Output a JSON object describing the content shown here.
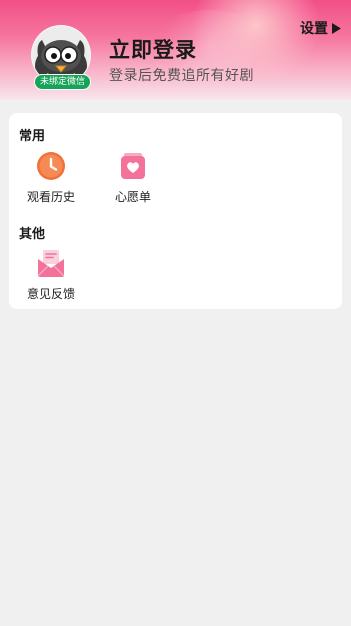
{
  "header": {
    "avatar_badge": "未绑定微信",
    "login_title": "立即登录",
    "login_subtitle": "登录后免费追所有好剧",
    "settings_label": "设置"
  },
  "sections": [
    {
      "title": "常用",
      "items": [
        {
          "label": "观看历史",
          "icon": "history-clock-icon"
        },
        {
          "label": "心愿单",
          "icon": "wishlist-heart-icon"
        }
      ]
    },
    {
      "title": "其他",
      "items": [
        {
          "label": "意见反馈",
          "icon": "feedback-mail-icon"
        }
      ]
    }
  ],
  "colors": {
    "header_pink": "#f24f87",
    "icon_orange": "#f2703a",
    "icon_pink": "#f3729a",
    "badge_green": "#18a35a",
    "page_bg": "#f0f0f0"
  }
}
